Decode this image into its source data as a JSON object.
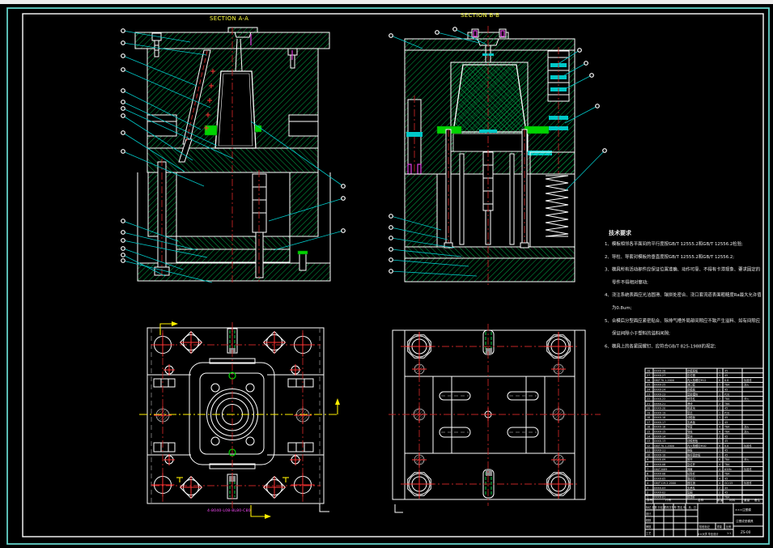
{
  "labels": {
    "section_a": "SECTION A-A",
    "section_b": "SECTION B-B"
  },
  "notes": {
    "title": "技术要求",
    "lines": [
      {
        "t": "1、模板相邻各平面间的平行度按GB/T 12555.2和GB/T 12556.2检验;",
        "i": 0
      },
      {
        "t": "2、导柱、导套对模板的垂直度按GB/T 12555.2和GB/T 12556.2;",
        "i": 0
      },
      {
        "t": "3、模具所有活动部件应保证位置准确、动作可靠、不得有卡滞现象、要求固定的",
        "i": 0
      },
      {
        "t": "零件不得相对窜动;",
        "i": 1
      },
      {
        "t": "4、浇注系统表面应光洁圆滑、镶拼处密合、浇口套流道表面粗糙度Ra最大允许值",
        "i": 0
      },
      {
        "t": "为0.8um;",
        "i": 1
      },
      {
        "t": "5、合模后分型面应紧密贴合、除排气槽外局部间隙应不致产生溢料、如有间隙应",
        "i": 0
      },
      {
        "t": "保证间隙小于塑料的溢料间隙;",
        "i": 1
      },
      {
        "t": "6、模具上的各紧固螺钉、应符合GB/T 825-1988的规定;",
        "i": 0
      }
    ]
  },
  "plan_left": {
    "dim_text": "4-8040-L08-8L80-C80"
  },
  "bom": {
    "headers": [
      "序号",
      "代号",
      "名称",
      "数量",
      "材料",
      "重量",
      "备注"
    ],
    "rows": [
      [
        "28",
        "XXXX-28",
        "定模座板",
        "1",
        "45",
        ""
      ],
      [
        "27",
        "XXXX-27",
        "定位圈",
        "1",
        "45",
        ""
      ],
      [
        "26",
        "GB/T70.1-2000",
        "内六角螺钉M12",
        "8",
        "8.8",
        "标准件"
      ],
      [
        "25",
        "XXXX-25",
        "浇口套",
        "1",
        "T8A",
        "淬火"
      ],
      [
        "24",
        "XXXX-24",
        "定模板",
        "1",
        "45",
        ""
      ],
      [
        "23",
        "XXXX-23",
        "型腔镶块",
        "1",
        "P20",
        ""
      ],
      [
        "22",
        "XXXX-22",
        "斜导柱",
        "2",
        "T8A",
        "淬火"
      ],
      [
        "21",
        "XXXX-21",
        "滑块",
        "2",
        "T8A",
        ""
      ],
      [
        "20",
        "XXXX-20",
        "楔紧块",
        "2",
        "45",
        ""
      ],
      [
        "19",
        "XXXX-19",
        "型芯",
        "1",
        "P20",
        ""
      ],
      [
        "18",
        "XXXX-18",
        "动模板",
        "1",
        "45",
        ""
      ],
      [
        "17",
        "XXXX-17",
        "支承板",
        "1",
        "45",
        ""
      ],
      [
        "16",
        "XXXX-16",
        "导套",
        "4",
        "T8A",
        "淬火"
      ],
      [
        "15",
        "XXXX-15",
        "导柱",
        "4",
        "T8A",
        "淬火"
      ],
      [
        "14",
        "XXXX-14",
        "垫块",
        "2",
        "45",
        ""
      ],
      [
        "13",
        "XXXX-13",
        "动模座板",
        "1",
        "45",
        ""
      ],
      [
        "12",
        "GB/T70.1-2000",
        "内六角螺钉M10",
        "8",
        "8.8",
        "标准件"
      ],
      [
        "11",
        "XXXX-11",
        "推板",
        "1",
        "45",
        ""
      ],
      [
        "10",
        "XXXX-10",
        "推杆固定板",
        "1",
        "45",
        ""
      ],
      [
        "9",
        "XXXX-09",
        "推杆",
        "6",
        "T8A",
        "淬火"
      ],
      [
        "8",
        "XXXX-08",
        "复位杆",
        "4",
        "T8A",
        ""
      ],
      [
        "7",
        "GB/T2089",
        "弹簧",
        "4",
        "65Mn",
        "标准件"
      ],
      [
        "6",
        "XXXX-06",
        "拉料杆",
        "1",
        "T8A",
        ""
      ],
      [
        "5",
        "XXXX-05",
        "限位钉",
        "4",
        "45",
        ""
      ],
      [
        "4",
        "GB/T119.2-2000",
        "圆柱销",
        "4",
        "GCr15",
        "标准件"
      ],
      [
        "3",
        "XXXX-03",
        "支承柱",
        "2",
        "45",
        ""
      ],
      [
        "2",
        "XXXX-02",
        "垫圈",
        "2",
        "45",
        ""
      ],
      [
        "1",
        "XXXX-01",
        "斜顶杆",
        "1",
        "T8A",
        ""
      ]
    ]
  },
  "title_block": {
    "sign_header": "标记 处数 分区 更改文件号 签名 年、月、日",
    "sign_rows": [
      "设计",
      "校核",
      "审核",
      "工艺",
      "批准"
    ],
    "stage_label": "阶段标记",
    "weight_label": "重量",
    "scale_label": "比例",
    "scale_value": "1:1",
    "school_label": "××大学 毕业设计",
    "name_top": "×××注塑模",
    "name_mid": "注塑成型模具",
    "drawing_no": "ZS-00"
  },
  "colors": {
    "background": "#000000",
    "sheet_frame_teal": "#63d1c8",
    "line_white": "#ffffff",
    "hatch_green": "#00a848",
    "highlight_green": "#00d400",
    "centerline_red": "#c02525",
    "bright_red": "#ff3434",
    "leader_cyan": "#00c8c8",
    "section_yellow": "#ffef00",
    "dim_magenta": "#ff4dff"
  }
}
